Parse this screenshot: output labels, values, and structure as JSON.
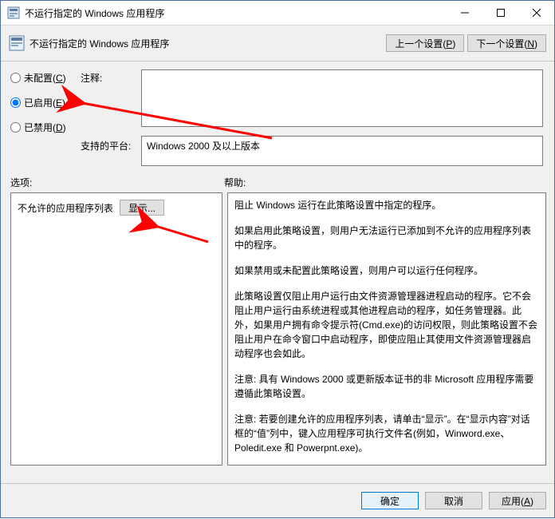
{
  "titlebar": {
    "title": "不运行指定的 Windows 应用程序"
  },
  "header": {
    "title": "不运行指定的 Windows 应用程序",
    "prev_btn": "上一个设置(P)",
    "next_btn": "下一个设置(N)"
  },
  "radios": {
    "not_configured": {
      "label": "未配置(",
      "key": "C",
      "close": ")"
    },
    "enabled": {
      "label": "已启用(",
      "key": "E",
      "close": ")"
    },
    "disabled": {
      "label": "已禁用(",
      "key": "D",
      "close": ")"
    }
  },
  "labels": {
    "comment": "注释:",
    "platform": "支持的平台:",
    "options": "选项:",
    "help": "帮助:"
  },
  "platform_text": "Windows 2000 及以上版本",
  "options": {
    "list_label": "不允许的应用程序列表",
    "show_btn": "显示..."
  },
  "help": {
    "p1": "阻止 Windows 运行在此策略设置中指定的程序。",
    "p2": "如果启用此策略设置，则用户无法运行已添加到不允许的应用程序列表中的程序。",
    "p3": "如果禁用或未配置此策略设置，则用户可以运行任何程序。",
    "p4": "此策略设置仅阻止用户运行由文件资源管理器进程启动的程序。它不会阻止用户运行由系统进程或其他进程启动的程序，如任务管理器。此外，如果用户拥有命令提示符(Cmd.exe)的访问权限，则此策略设置不会阻止用户在命令窗口中启动程序，即使应阻止其使用文件资源管理器启动程序也会如此。",
    "p5": "注意: 具有 Windows 2000 或更新版本证书的非 Microsoft 应用程序需要遵循此策略设置。",
    "p6": "注意: 若要创建允许的应用程序列表，请单击“显示”。在“显示内容”对话框的“值”列中，键入应用程序可执行文件名(例如，Winword.exe、Poledit.exe 和 Powerpnt.exe)。"
  },
  "footer": {
    "ok": "确定",
    "cancel": "取消",
    "apply": "应用(A)"
  }
}
